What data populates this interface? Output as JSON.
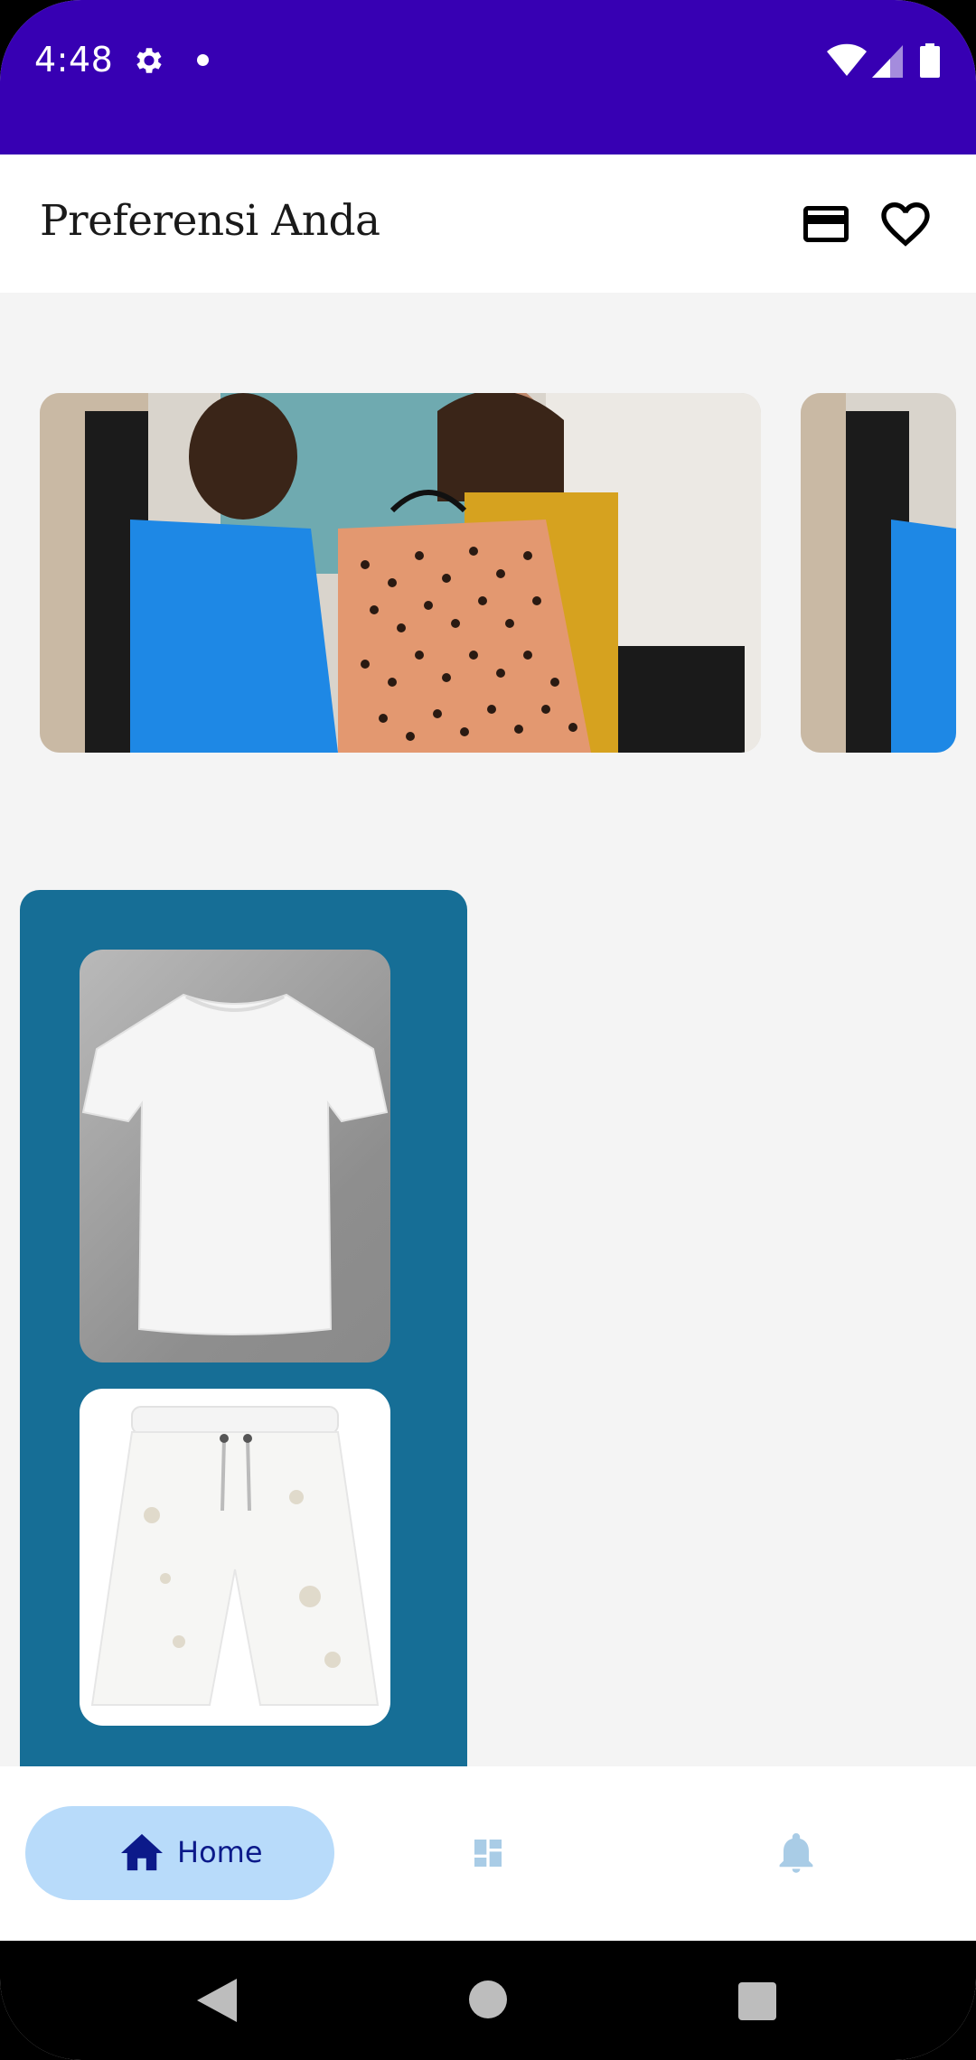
{
  "status_bar": {
    "time": "4:48",
    "background_color": "#3700b3"
  },
  "app_bar": {
    "title": "Preferensi Anda",
    "icons": [
      "credit-card-icon",
      "heart-icon"
    ]
  },
  "carousel": {
    "items": [
      {
        "description_icon": "shopping-photo-icon"
      },
      {
        "description_icon": "shopping-photo-icon"
      }
    ]
  },
  "products": {
    "panel_color": "#166e96",
    "items": [
      {
        "icon": "tshirt-image"
      },
      {
        "icon": "shorts-image"
      }
    ]
  },
  "bottom_nav": {
    "items": [
      {
        "label": "Home",
        "icon": "home-icon",
        "selected": true
      },
      {
        "label": "",
        "icon": "dashboard-icon",
        "selected": false
      },
      {
        "label": "",
        "icon": "bell-icon",
        "selected": false
      }
    ],
    "selected_pill_color": "#b8dbfa",
    "selected_text_color": "#0c1a8a",
    "inactive_icon_color": "#a9cce6"
  }
}
